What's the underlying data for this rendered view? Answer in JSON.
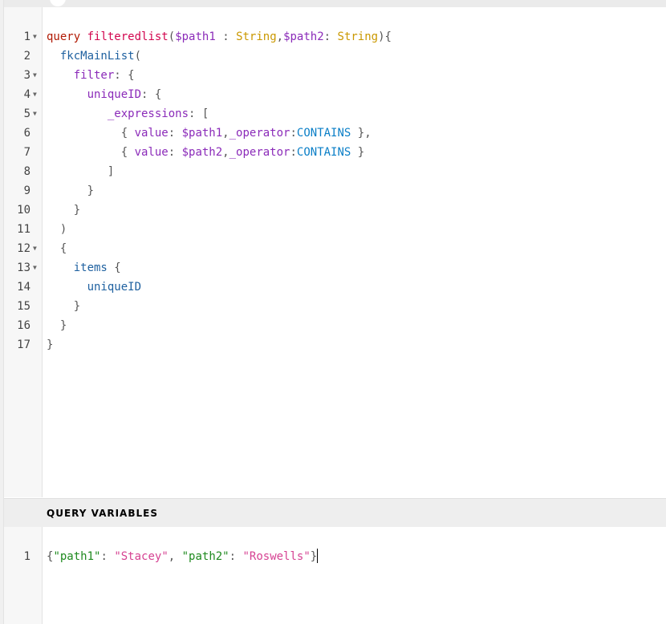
{
  "query_editor": {
    "lines": [
      {
        "n": "1",
        "fold": true
      },
      {
        "n": "2",
        "fold": false
      },
      {
        "n": "3",
        "fold": true
      },
      {
        "n": "4",
        "fold": true
      },
      {
        "n": "5",
        "fold": true
      },
      {
        "n": "6",
        "fold": false
      },
      {
        "n": "7",
        "fold": false
      },
      {
        "n": "8",
        "fold": false
      },
      {
        "n": "9",
        "fold": false
      },
      {
        "n": "10",
        "fold": false
      },
      {
        "n": "11",
        "fold": false
      },
      {
        "n": "12",
        "fold": true
      },
      {
        "n": "13",
        "fold": true
      },
      {
        "n": "14",
        "fold": false
      },
      {
        "n": "15",
        "fold": false
      },
      {
        "n": "16",
        "fold": false
      },
      {
        "n": "17",
        "fold": false
      }
    ],
    "tokens": {
      "l1_query": "query",
      "l1_name": "filteredlist",
      "l1_p1": "(",
      "l1_var1": "$path1",
      "l1_colon1": " : ",
      "l1_type1": "String",
      "l1_comma": ",",
      "l1_var2": "$path2",
      "l1_colon2": ": ",
      "l1_type2": "String",
      "l1_end": "){",
      "l2_field": "fkcMainList",
      "l2_paren": "(",
      "l3_arg": "filter",
      "l3_rest": ": {",
      "l4_arg": "uniqueID",
      "l4_rest": ": {",
      "l5_arg": "_expressions",
      "l5_rest": ": [",
      "l6_open": "{ ",
      "l6_arg1": "value",
      "l6_c1": ": ",
      "l6_var": "$path1",
      "l6_comma": ",",
      "l6_arg2": "_operator",
      "l6_c2": ":",
      "l6_enum": "CONTAINS",
      "l6_close": " },",
      "l7_open": "{ ",
      "l7_arg1": "value",
      "l7_c1": ": ",
      "l7_var": "$path2",
      "l7_comma": ",",
      "l7_arg2": "_operator",
      "l7_c2": ":",
      "l7_enum": "CONTAINS",
      "l7_close": " }",
      "l8": "]",
      "l9": "}",
      "l10": "}",
      "l11": ")",
      "l12": "{",
      "l13_field": "items",
      "l13_rest": " {",
      "l14_field": "uniqueID",
      "l15": "}",
      "l16": "}",
      "l17": "}"
    }
  },
  "variables_panel": {
    "title": "QUERY VARIABLES",
    "line_number": "1",
    "tokens": {
      "open": "{",
      "key1": "\"path1\"",
      "colon1": ": ",
      "val1": "\"Stacey\"",
      "comma": ", ",
      "key2": "\"path2\"",
      "colon2": ": ",
      "val2": "\"Roswells\"",
      "close": "}"
    }
  }
}
